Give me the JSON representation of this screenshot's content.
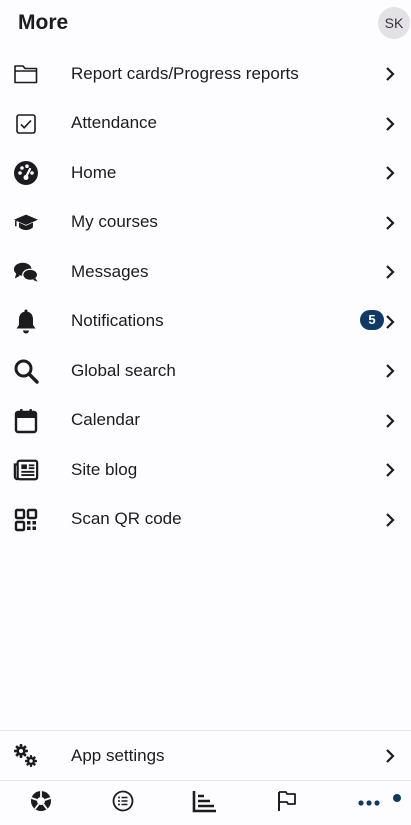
{
  "header": {
    "title": "More",
    "avatar_initials": "SK"
  },
  "menu": [
    {
      "label": "Report cards/Progress reports",
      "icon": "folder-icon"
    },
    {
      "label": "Attendance",
      "icon": "checkbox-icon"
    },
    {
      "label": "Home",
      "icon": "dashboard-icon"
    },
    {
      "label": "My courses",
      "icon": "graduation-cap-icon"
    },
    {
      "label": "Messages",
      "icon": "chat-bubbles-icon"
    },
    {
      "label": "Notifications",
      "icon": "bell-icon",
      "badge": "5"
    },
    {
      "label": "Global search",
      "icon": "search-icon"
    },
    {
      "label": "Calendar",
      "icon": "calendar-icon"
    },
    {
      "label": "Site blog",
      "icon": "newspaper-icon"
    },
    {
      "label": "Scan QR code",
      "icon": "qr-code-icon"
    }
  ],
  "settings": {
    "label": "App settings",
    "icon": "gears-icon"
  },
  "bottom_nav": [
    {
      "icon": "aperture-icon"
    },
    {
      "icon": "list-icon"
    },
    {
      "icon": "bar-chart-icon"
    },
    {
      "icon": "flag-icon"
    },
    {
      "icon": "more-dots-icon",
      "active": true
    }
  ],
  "colors": {
    "accent": "#0f3a66",
    "text": "#1c1b1f",
    "background": "#fdfcfe"
  }
}
